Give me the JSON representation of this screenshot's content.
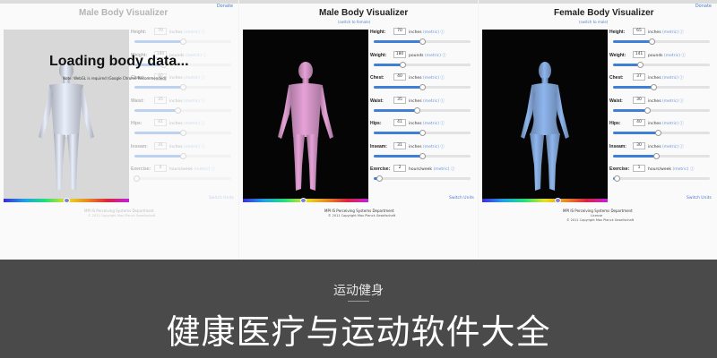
{
  "panels": [
    {
      "title": "Male Body Visualizer",
      "subtitle": "",
      "topbar_link": "Donate",
      "state": "loading",
      "loading_title": "Loading body data...",
      "loading_note": "Note: WebGL is required (Google Chrome Recommended)",
      "figure": "male",
      "figure_color": "#e8eefb",
      "hue_position": 0.5,
      "controls": [
        {
          "label": "Height:",
          "value": "70",
          "unit": "inches",
          "link": "(metric)",
          "fill": 0.5
        },
        {
          "label": "Weight:",
          "value": "180",
          "unit": "pounds",
          "link": "(metric)",
          "fill": 0.3
        },
        {
          "label": "Chest:",
          "value": "40",
          "unit": "inches",
          "link": "(metric)",
          "fill": 0.5
        },
        {
          "label": "Waist:",
          "value": "35",
          "unit": "inches",
          "link": "(metric)",
          "fill": 0.45
        },
        {
          "label": "Hips:",
          "value": "41",
          "unit": "inches",
          "link": "(metric)",
          "fill": 0.5
        },
        {
          "label": "Inseam:",
          "value": "31",
          "unit": "inches",
          "link": "(metric)",
          "fill": 0.5
        },
        {
          "label": "Exercise:",
          "value": "0",
          "unit": "hours/week",
          "link": "(metric)",
          "fill": 0.02
        }
      ],
      "switch_label": "Switch Units",
      "footer_line1": "MPI IS Perceiving Systems Department",
      "footer_line2": "© 2011 Copyright Max Planck Gesellschaft",
      "footer_line3": ""
    },
    {
      "title": "Male Body Visualizer",
      "subtitle": "(switch to female)",
      "topbar_link": "",
      "state": "loaded",
      "loading_title": "",
      "loading_note": "",
      "figure": "male",
      "figure_color": "#e6a2d8",
      "hue_position": 0.48,
      "controls": [
        {
          "label": "Height:",
          "value": "70",
          "unit": "inches",
          "link": "(metric)",
          "fill": 0.5
        },
        {
          "label": "Weight:",
          "value": "180",
          "unit": "pounds",
          "link": "(metric)",
          "fill": 0.3
        },
        {
          "label": "Chest:",
          "value": "40",
          "unit": "inches",
          "link": "(metric)",
          "fill": 0.5
        },
        {
          "label": "Waist:",
          "value": "35",
          "unit": "inches",
          "link": "(metric)",
          "fill": 0.45
        },
        {
          "label": "Hips:",
          "value": "41",
          "unit": "inches",
          "link": "(metric)",
          "fill": 0.5
        },
        {
          "label": "Inseam:",
          "value": "31",
          "unit": "inches",
          "link": "(metric)",
          "fill": 0.5
        },
        {
          "label": "Exercise:",
          "value": "2",
          "unit": "hours/week",
          "link": "(metric)",
          "fill": 0.06
        }
      ],
      "switch_label": "Switch Units",
      "footer_line1": "MPI IS Perceiving Systems Department",
      "footer_line2": "© 2011 Copyright Max Planck Gesellschaft",
      "footer_line3": ""
    },
    {
      "title": "Female Body Visualizer",
      "subtitle": "(switch to male)",
      "topbar_link": "Donate",
      "state": "loaded",
      "loading_title": "",
      "loading_note": "",
      "figure": "female",
      "figure_color": "#8fb6ee",
      "hue_position": 0.6,
      "controls": [
        {
          "label": "Height:",
          "value": "65",
          "unit": "inches",
          "link": "(metric)",
          "fill": 0.4
        },
        {
          "label": "Weight:",
          "value": "141",
          "unit": "pounds",
          "link": "(metric)",
          "fill": 0.28
        },
        {
          "label": "Chest:",
          "value": "37",
          "unit": "inches",
          "link": "(metric)",
          "fill": 0.42
        },
        {
          "label": "Waist:",
          "value": "30",
          "unit": "inches",
          "link": "(metric)",
          "fill": 0.36
        },
        {
          "label": "Hips:",
          "value": "40",
          "unit": "inches",
          "link": "(metric)",
          "fill": 0.47
        },
        {
          "label": "Inseam:",
          "value": "30",
          "unit": "inches",
          "link": "(metric)",
          "fill": 0.45
        },
        {
          "label": "Exercise:",
          "value": "1",
          "unit": "hours/week",
          "link": "(metric)",
          "fill": 0.04
        }
      ],
      "switch_label": "Switch Units",
      "footer_line1": "MPI IS Perceiving Systems Department",
      "footer_line2": "License",
      "footer_line3": "© 2011 Copyright Max Planck Gesellschaft"
    }
  ],
  "banner": {
    "category": "运动健身",
    "headline": "健康医疗与运动软件大全",
    "background": "#4a4a4a"
  }
}
